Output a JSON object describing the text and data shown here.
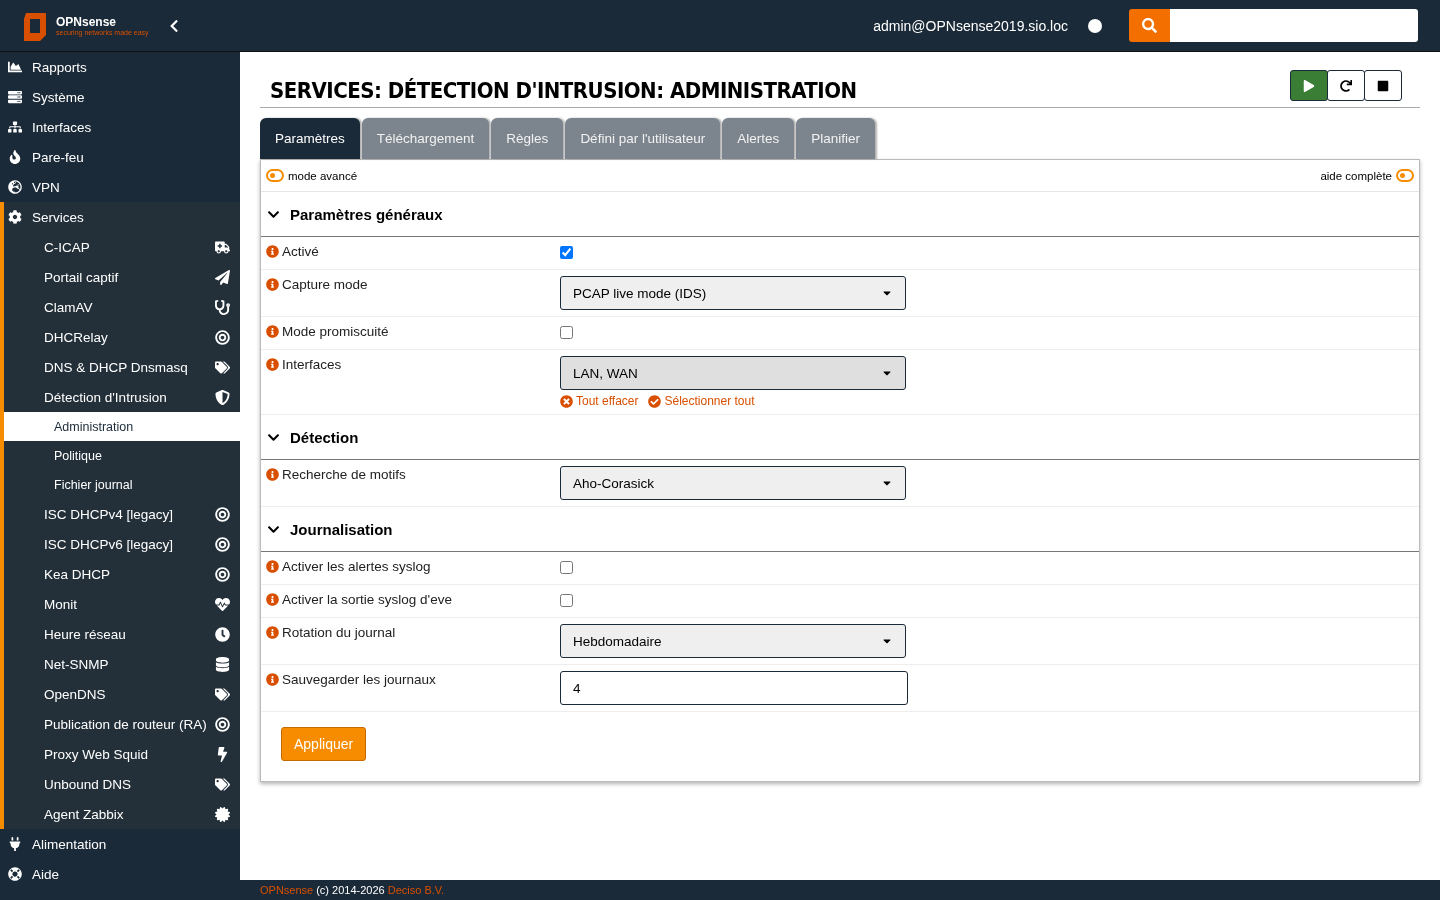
{
  "header": {
    "logo_text": "OPNsense",
    "logo_tagline": "securing networks made easy",
    "user": "admin@OPNsense2019.sio.loc"
  },
  "sidebar": {
    "items": [
      {
        "label": "Rapports",
        "selected": false
      },
      {
        "label": "Système",
        "selected": false
      },
      {
        "label": "Interfaces",
        "selected": false
      },
      {
        "label": "Pare-feu",
        "selected": false
      },
      {
        "label": "VPN",
        "selected": false
      },
      {
        "label": "Services",
        "selected": false,
        "expanded": true,
        "children": [
          {
            "label": "C-ICAP",
            "selected": false
          },
          {
            "label": "Portail captif",
            "selected": false
          },
          {
            "label": "ClamAV",
            "selected": false
          },
          {
            "label": "DHCRelay",
            "selected": false
          },
          {
            "label": "DNS & DHCP Dnsmasq",
            "selected": false
          },
          {
            "label": "Détection d'Intrusion",
            "selected": false,
            "expanded": true,
            "children": [
              {
                "label": "Administration",
                "selected": true
              },
              {
                "label": "Politique",
                "selected": false
              },
              {
                "label": "Fichier journal",
                "selected": false
              }
            ]
          },
          {
            "label": "ISC DHCPv4 [legacy]",
            "selected": false
          },
          {
            "label": "ISC DHCPv6 [legacy]",
            "selected": false
          },
          {
            "label": "Kea DHCP",
            "selected": false
          },
          {
            "label": "Monit",
            "selected": false
          },
          {
            "label": "Heure réseau",
            "selected": false
          },
          {
            "label": "Net-SNMP",
            "selected": false
          },
          {
            "label": "OpenDNS",
            "selected": false
          },
          {
            "label": "Publication de routeur (RA)",
            "selected": false
          },
          {
            "label": "Proxy Web Squid",
            "selected": false
          },
          {
            "label": "Unbound DNS",
            "selected": false
          },
          {
            "label": "Agent Zabbix",
            "selected": false
          }
        ]
      },
      {
        "label": "Alimentation",
        "selected": false
      },
      {
        "label": "Aide",
        "selected": false
      }
    ]
  },
  "page": {
    "title": "SERVICES: DÉTECTION D'INTRUSION: ADMINISTRATION",
    "tabs": [
      {
        "label": "Paramètres",
        "selected": true
      },
      {
        "label": "Téléchargement",
        "selected": false
      },
      {
        "label": "Règles",
        "selected": false
      },
      {
        "label": "Défini par l'utilisateur",
        "selected": false
      },
      {
        "label": "Alertes",
        "selected": false
      },
      {
        "label": "Planifier",
        "selected": false
      }
    ],
    "advanced_mode": {
      "label": "mode avancé",
      "on": false
    },
    "full_help": {
      "label": "aide complète",
      "on": false
    },
    "sections": [
      {
        "title": "Paramètres généraux",
        "expanded": true,
        "fields": [
          {
            "kind": "checkbox",
            "label": "Activé",
            "checked": true
          },
          {
            "kind": "select",
            "label": "Capture mode",
            "value": "PCAP live mode (IDS)"
          },
          {
            "kind": "checkbox",
            "label": "Mode promiscuité",
            "checked": false
          },
          {
            "kind": "multiselect",
            "label": "Interfaces",
            "value": "LAN, WAN",
            "clear": "Tout effacer",
            "select_all": "Sélectionner tout"
          }
        ]
      },
      {
        "title": "Détection",
        "expanded": true,
        "fields": [
          {
            "kind": "select",
            "label": "Recherche de motifs",
            "value": "Aho-Corasick"
          }
        ]
      },
      {
        "title": "Journalisation",
        "expanded": true,
        "fields": [
          {
            "kind": "checkbox",
            "label": "Activer les alertes syslog",
            "checked": false
          },
          {
            "kind": "checkbox",
            "label": "Activer la sortie syslog d'eve",
            "checked": false
          },
          {
            "kind": "select",
            "label": "Rotation du journal",
            "value": "Hebdomadaire"
          },
          {
            "kind": "input",
            "label": "Sauvegarder les journaux",
            "value": "4"
          }
        ]
      }
    ],
    "apply_button": "Appliquer"
  },
  "footer": {
    "brand": "OPNsense",
    "copyright": "(c) 2014-2026",
    "company": "Deciso B.V."
  }
}
